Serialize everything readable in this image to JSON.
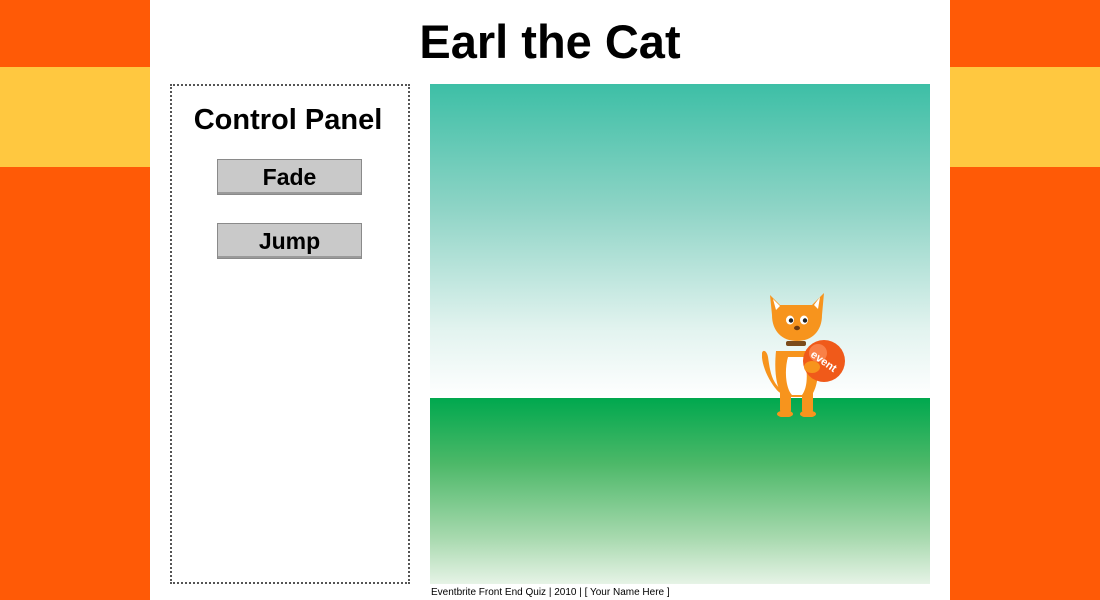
{
  "page": {
    "title": "Earl the Cat"
  },
  "control_panel": {
    "title": "Control Panel",
    "buttons": {
      "fade_label": "Fade",
      "jump_label": "Jump"
    }
  },
  "stage": {
    "cat_ball_text": "event"
  },
  "footer": {
    "text": "Eventbrite Front End Quiz | 2010 | [ Your Name Here ]"
  },
  "colors": {
    "side_orange": "#ff5a06",
    "band_yellow": "#ffc840",
    "sky_teal": "#3dbfa6",
    "ground_green": "#00a84e",
    "cat_orange": "#f7941d",
    "button_gray": "#c9c9c9"
  }
}
